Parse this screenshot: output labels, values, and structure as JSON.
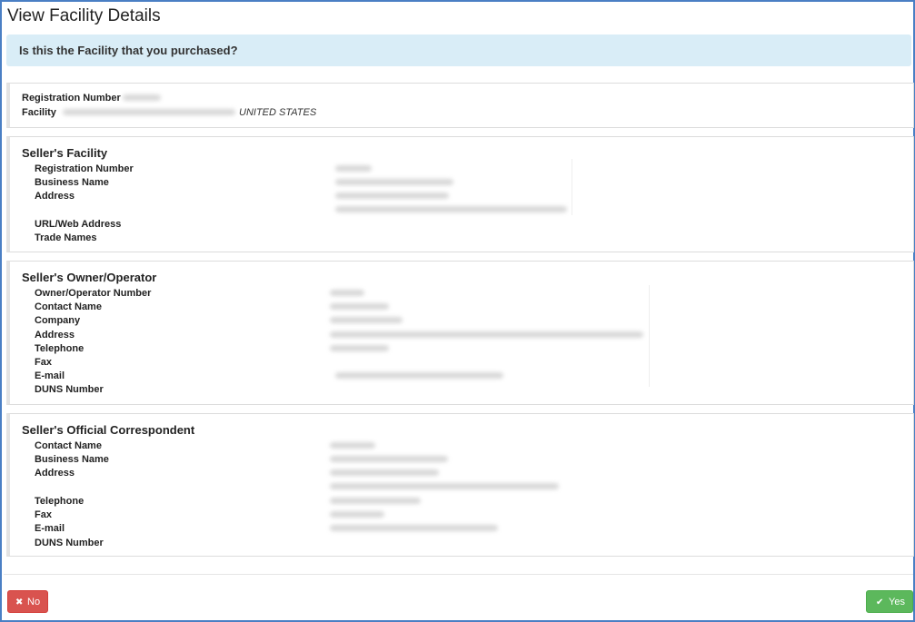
{
  "page": {
    "title": "View Facility Details"
  },
  "question": "Is this the Facility that you purchased?",
  "summary": {
    "registration_label": "Registration Number",
    "facility_label": "Facility",
    "facility_country": "UNITED STATES"
  },
  "seller_facility": {
    "heading": "Seller's Facility",
    "labels": [
      "Registration Number",
      "Business Name",
      "Address",
      "URL/Web Address",
      "Trade Names"
    ]
  },
  "seller_owner": {
    "heading": "Seller's Owner/Operator",
    "labels": [
      "Owner/Operator Number",
      "Contact Name",
      "Company",
      "Address",
      "Telephone",
      "Fax",
      "E-mail",
      "DUNS Number"
    ]
  },
  "seller_correspondent": {
    "heading": "Seller's Official Correspondent",
    "labels": [
      "Contact Name",
      "Business Name",
      "Address",
      "Telephone",
      "Fax",
      "E-mail",
      "DUNS Number"
    ]
  },
  "buttons": {
    "no_icon": "close-icon",
    "no_label": "No",
    "yes_icon": "check-icon",
    "yes_label": "Yes"
  },
  "colors": {
    "frame_border": "#4a7fc4",
    "question_bg": "#d9edf7",
    "no_button": "#d9534f",
    "yes_button": "#5cb85c"
  }
}
